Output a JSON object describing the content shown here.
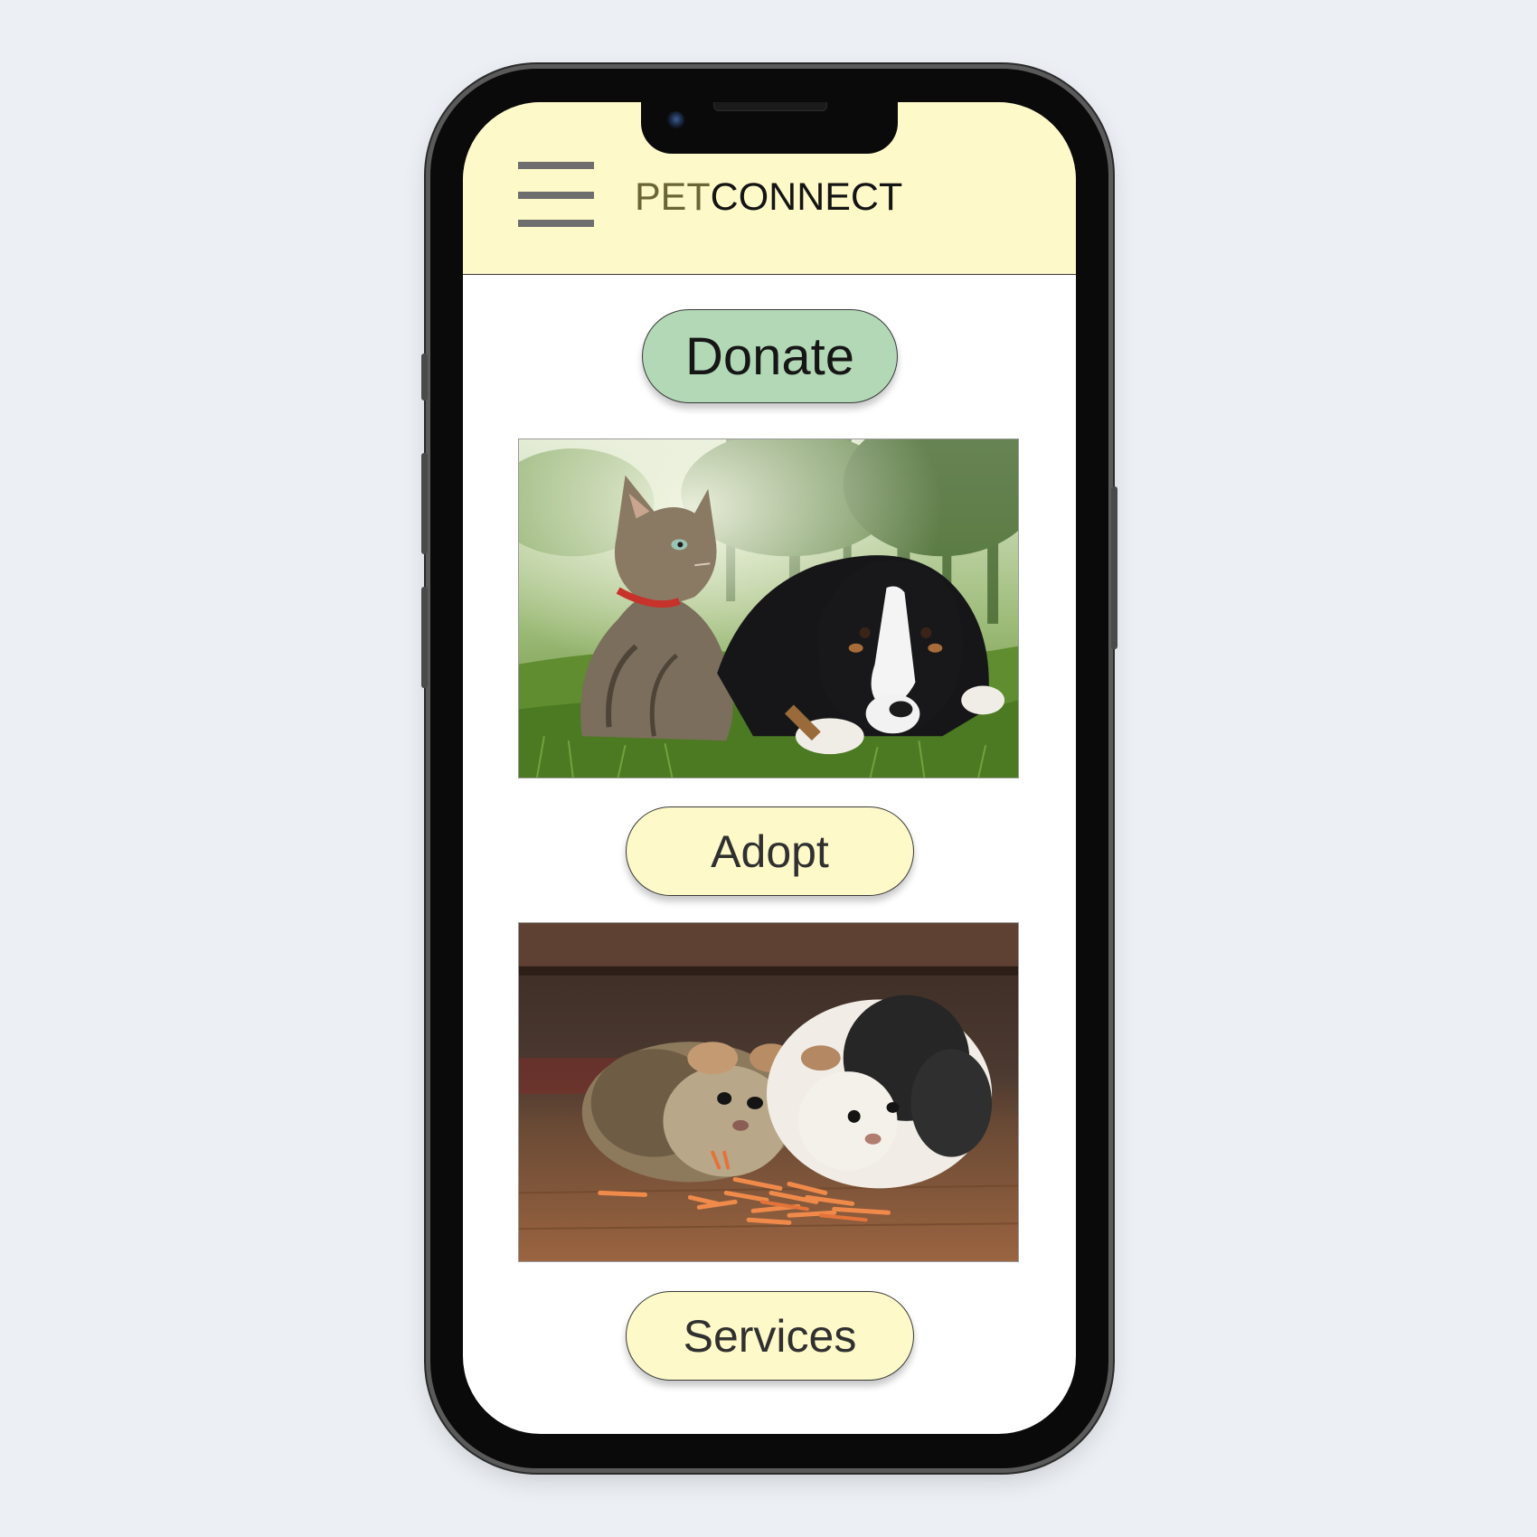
{
  "app": {
    "brand_prefix": "PET",
    "brand_suffix": "CONNECT"
  },
  "actions": {
    "donate_label": "Donate",
    "adopt_label": "Adopt",
    "services_label": "Services"
  },
  "icons": {
    "menu": "hamburger-menu-icon"
  },
  "colors": {
    "header_bg": "#fdf9c8",
    "donate_bg": "#b2d8b6",
    "pill_bg": "#fdf9c8",
    "page_bg": "#ecf0f5"
  },
  "images": {
    "first": "cat-and-puppy-photo",
    "second": "guinea-pigs-photo"
  }
}
